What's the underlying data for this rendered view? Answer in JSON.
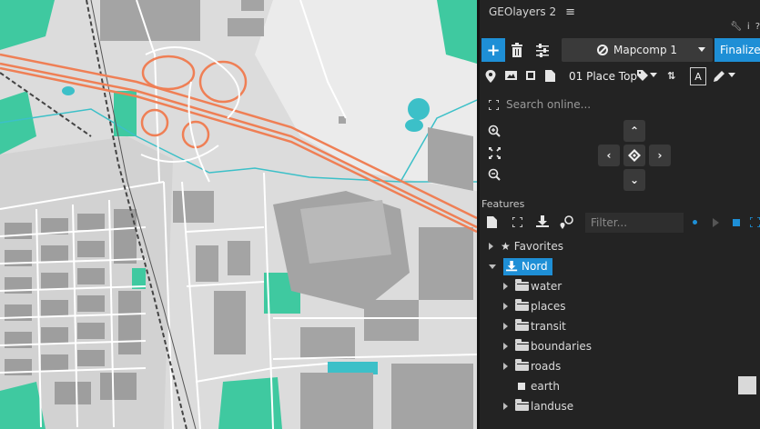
{
  "panel": {
    "title": "GEOlayers 2",
    "menu_icon": "hamburger-icon",
    "top_tools": [
      "wrench-icon",
      "info-icon",
      "help-icon"
    ],
    "toolbar1": {
      "add_icon": "plus-icon",
      "delete_icon": "trash-icon",
      "settings_icon": "sliders-icon",
      "comp_name": "Mapcomp 1",
      "finalize_label": "Finalize"
    },
    "toolbar2": {
      "icons": [
        "pin-icon",
        "image-icon",
        "crop-icon",
        "document-icon"
      ],
      "place_label": "01 Place Top",
      "tag_icon": "tag-icon",
      "sort_icon": "sort-icon",
      "text_button": "A",
      "pen_icon": "pen-icon"
    },
    "search": {
      "icon": "expand-icon",
      "placeholder": "Search online..."
    },
    "zoom": [
      "zoom-in-icon",
      "fit-icon",
      "zoom-out-icon"
    ],
    "dpad": [
      "up-icon",
      "left-icon",
      "center-icon",
      "right-icon",
      "down-icon"
    ],
    "features": {
      "label": "Features",
      "tools": [
        "new-document-icon",
        "expand-icon",
        "download-icon",
        "search-location-icon"
      ],
      "filter_placeholder": "Filter...",
      "right_tools": [
        "dot-icon",
        "play-icon",
        "square-icon",
        "expand-icon"
      ]
    },
    "tree": {
      "favorites": "Favorites",
      "nord": "Nord",
      "children": [
        "water",
        "places",
        "transit",
        "boundaries",
        "roads",
        "earth",
        "landuse"
      ]
    }
  },
  "colors": {
    "accent": "#1e8fd6",
    "panel_bg": "#232323",
    "map_bg": "#dcdcdc",
    "building": "#9e9e9e",
    "park": "#3fc9a0",
    "highway": "#ef7f55",
    "water": "#3cc0c8"
  }
}
